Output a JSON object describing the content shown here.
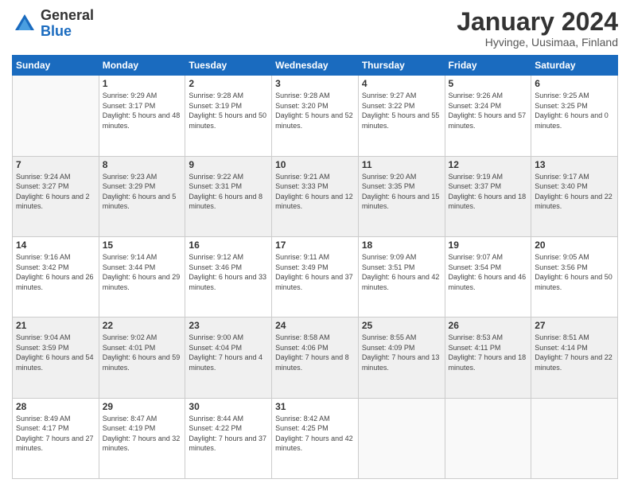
{
  "logo": {
    "line1": "General",
    "line2": "Blue"
  },
  "title": "January 2024",
  "subtitle": "Hyvinge, Uusimaa, Finland",
  "days_of_week": [
    "Sunday",
    "Monday",
    "Tuesday",
    "Wednesday",
    "Thursday",
    "Friday",
    "Saturday"
  ],
  "weeks": [
    [
      {
        "num": "",
        "sunrise": "",
        "sunset": "",
        "daylight": ""
      },
      {
        "num": "1",
        "sunrise": "Sunrise: 9:29 AM",
        "sunset": "Sunset: 3:17 PM",
        "daylight": "Daylight: 5 hours and 48 minutes."
      },
      {
        "num": "2",
        "sunrise": "Sunrise: 9:28 AM",
        "sunset": "Sunset: 3:19 PM",
        "daylight": "Daylight: 5 hours and 50 minutes."
      },
      {
        "num": "3",
        "sunrise": "Sunrise: 9:28 AM",
        "sunset": "Sunset: 3:20 PM",
        "daylight": "Daylight: 5 hours and 52 minutes."
      },
      {
        "num": "4",
        "sunrise": "Sunrise: 9:27 AM",
        "sunset": "Sunset: 3:22 PM",
        "daylight": "Daylight: 5 hours and 55 minutes."
      },
      {
        "num": "5",
        "sunrise": "Sunrise: 9:26 AM",
        "sunset": "Sunset: 3:24 PM",
        "daylight": "Daylight: 5 hours and 57 minutes."
      },
      {
        "num": "6",
        "sunrise": "Sunrise: 9:25 AM",
        "sunset": "Sunset: 3:25 PM",
        "daylight": "Daylight: 6 hours and 0 minutes."
      }
    ],
    [
      {
        "num": "7",
        "sunrise": "Sunrise: 9:24 AM",
        "sunset": "Sunset: 3:27 PM",
        "daylight": "Daylight: 6 hours and 2 minutes."
      },
      {
        "num": "8",
        "sunrise": "Sunrise: 9:23 AM",
        "sunset": "Sunset: 3:29 PM",
        "daylight": "Daylight: 6 hours and 5 minutes."
      },
      {
        "num": "9",
        "sunrise": "Sunrise: 9:22 AM",
        "sunset": "Sunset: 3:31 PM",
        "daylight": "Daylight: 6 hours and 8 minutes."
      },
      {
        "num": "10",
        "sunrise": "Sunrise: 9:21 AM",
        "sunset": "Sunset: 3:33 PM",
        "daylight": "Daylight: 6 hours and 12 minutes."
      },
      {
        "num": "11",
        "sunrise": "Sunrise: 9:20 AM",
        "sunset": "Sunset: 3:35 PM",
        "daylight": "Daylight: 6 hours and 15 minutes."
      },
      {
        "num": "12",
        "sunrise": "Sunrise: 9:19 AM",
        "sunset": "Sunset: 3:37 PM",
        "daylight": "Daylight: 6 hours and 18 minutes."
      },
      {
        "num": "13",
        "sunrise": "Sunrise: 9:17 AM",
        "sunset": "Sunset: 3:40 PM",
        "daylight": "Daylight: 6 hours and 22 minutes."
      }
    ],
    [
      {
        "num": "14",
        "sunrise": "Sunrise: 9:16 AM",
        "sunset": "Sunset: 3:42 PM",
        "daylight": "Daylight: 6 hours and 26 minutes."
      },
      {
        "num": "15",
        "sunrise": "Sunrise: 9:14 AM",
        "sunset": "Sunset: 3:44 PM",
        "daylight": "Daylight: 6 hours and 29 minutes."
      },
      {
        "num": "16",
        "sunrise": "Sunrise: 9:12 AM",
        "sunset": "Sunset: 3:46 PM",
        "daylight": "Daylight: 6 hours and 33 minutes."
      },
      {
        "num": "17",
        "sunrise": "Sunrise: 9:11 AM",
        "sunset": "Sunset: 3:49 PM",
        "daylight": "Daylight: 6 hours and 37 minutes."
      },
      {
        "num": "18",
        "sunrise": "Sunrise: 9:09 AM",
        "sunset": "Sunset: 3:51 PM",
        "daylight": "Daylight: 6 hours and 42 minutes."
      },
      {
        "num": "19",
        "sunrise": "Sunrise: 9:07 AM",
        "sunset": "Sunset: 3:54 PM",
        "daylight": "Daylight: 6 hours and 46 minutes."
      },
      {
        "num": "20",
        "sunrise": "Sunrise: 9:05 AM",
        "sunset": "Sunset: 3:56 PM",
        "daylight": "Daylight: 6 hours and 50 minutes."
      }
    ],
    [
      {
        "num": "21",
        "sunrise": "Sunrise: 9:04 AM",
        "sunset": "Sunset: 3:59 PM",
        "daylight": "Daylight: 6 hours and 54 minutes."
      },
      {
        "num": "22",
        "sunrise": "Sunrise: 9:02 AM",
        "sunset": "Sunset: 4:01 PM",
        "daylight": "Daylight: 6 hours and 59 minutes."
      },
      {
        "num": "23",
        "sunrise": "Sunrise: 9:00 AM",
        "sunset": "Sunset: 4:04 PM",
        "daylight": "Daylight: 7 hours and 4 minutes."
      },
      {
        "num": "24",
        "sunrise": "Sunrise: 8:58 AM",
        "sunset": "Sunset: 4:06 PM",
        "daylight": "Daylight: 7 hours and 8 minutes."
      },
      {
        "num": "25",
        "sunrise": "Sunrise: 8:55 AM",
        "sunset": "Sunset: 4:09 PM",
        "daylight": "Daylight: 7 hours and 13 minutes."
      },
      {
        "num": "26",
        "sunrise": "Sunrise: 8:53 AM",
        "sunset": "Sunset: 4:11 PM",
        "daylight": "Daylight: 7 hours and 18 minutes."
      },
      {
        "num": "27",
        "sunrise": "Sunrise: 8:51 AM",
        "sunset": "Sunset: 4:14 PM",
        "daylight": "Daylight: 7 hours and 22 minutes."
      }
    ],
    [
      {
        "num": "28",
        "sunrise": "Sunrise: 8:49 AM",
        "sunset": "Sunset: 4:17 PM",
        "daylight": "Daylight: 7 hours and 27 minutes."
      },
      {
        "num": "29",
        "sunrise": "Sunrise: 8:47 AM",
        "sunset": "Sunset: 4:19 PM",
        "daylight": "Daylight: 7 hours and 32 minutes."
      },
      {
        "num": "30",
        "sunrise": "Sunrise: 8:44 AM",
        "sunset": "Sunset: 4:22 PM",
        "daylight": "Daylight: 7 hours and 37 minutes."
      },
      {
        "num": "31",
        "sunrise": "Sunrise: 8:42 AM",
        "sunset": "Sunset: 4:25 PM",
        "daylight": "Daylight: 7 hours and 42 minutes."
      },
      {
        "num": "",
        "sunrise": "",
        "sunset": "",
        "daylight": ""
      },
      {
        "num": "",
        "sunrise": "",
        "sunset": "",
        "daylight": ""
      },
      {
        "num": "",
        "sunrise": "",
        "sunset": "",
        "daylight": ""
      }
    ]
  ]
}
